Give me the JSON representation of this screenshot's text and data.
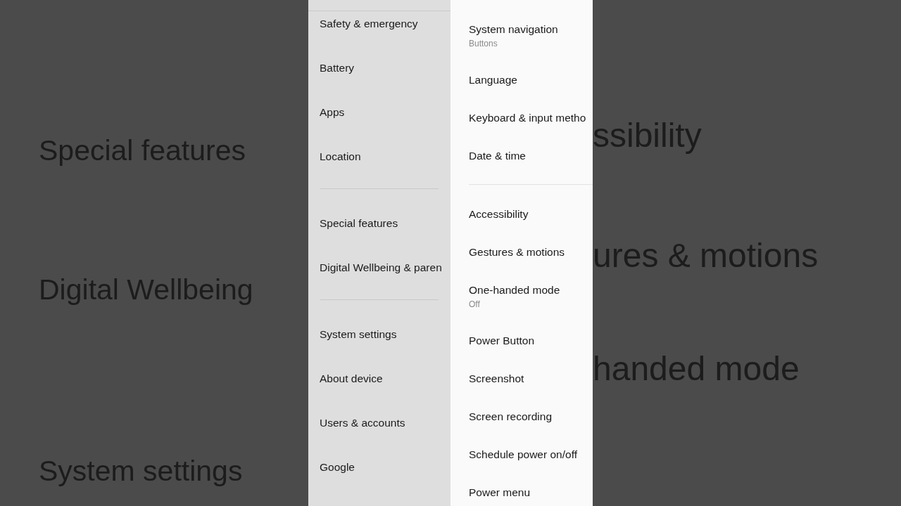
{
  "backdrop": {
    "left_texts": [
      "Special features",
      "Digital Wellbeing",
      "System settings"
    ],
    "right_texts": [
      "ssibility",
      "ures & motions",
      "handed mode"
    ]
  },
  "settings_menu": {
    "groups": [
      {
        "items": [
          {
            "label": "Safety & emergency"
          },
          {
            "label": "Battery"
          },
          {
            "label": "Apps"
          },
          {
            "label": "Location"
          }
        ]
      },
      {
        "items": [
          {
            "label": "Special features"
          },
          {
            "label": "Digital Wellbeing & paren"
          }
        ]
      },
      {
        "items": [
          {
            "label": "System settings"
          },
          {
            "label": "About device"
          },
          {
            "label": "Users & accounts"
          },
          {
            "label": "Google"
          }
        ]
      }
    ]
  },
  "system_settings": {
    "groups": [
      {
        "items": [
          {
            "title": "System navigation",
            "subtitle": "Buttons"
          },
          {
            "title": "Language"
          },
          {
            "title": "Keyboard & input metho"
          },
          {
            "title": "Date & time"
          }
        ]
      },
      {
        "items": [
          {
            "title": "Accessibility"
          },
          {
            "title": "Gestures & motions"
          },
          {
            "title": "One-handed mode",
            "subtitle": "Off"
          },
          {
            "title": "Power Button"
          },
          {
            "title": "Screenshot"
          },
          {
            "title": "Screen recording"
          },
          {
            "title": "Schedule power on/off"
          },
          {
            "title": "Power menu"
          }
        ]
      }
    ]
  }
}
